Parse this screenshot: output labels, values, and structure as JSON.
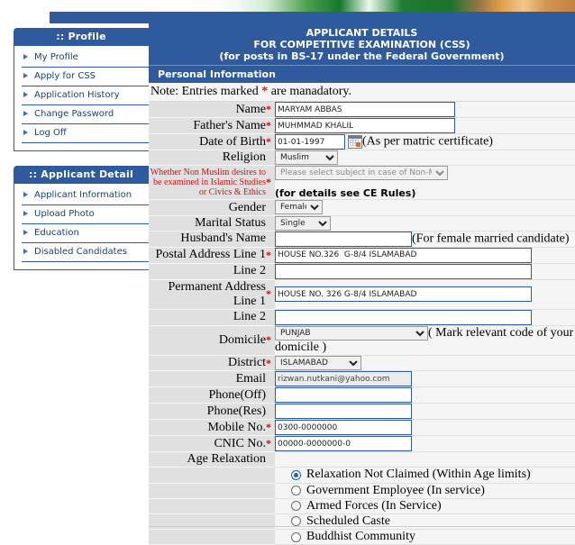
{
  "banner": {
    "alt": "flag-banner-strip"
  },
  "sidebar": {
    "panels": [
      {
        "title": ":: Profile",
        "items": [
          {
            "label": "My Profile"
          },
          {
            "label": "Apply for CSS"
          },
          {
            "label": "Application History"
          },
          {
            "label": "Change Password"
          },
          {
            "label": "Log Off"
          }
        ]
      },
      {
        "title": ":: Applicant Detail",
        "items": [
          {
            "label": "Applicant Information"
          },
          {
            "label": "Upload Photo"
          },
          {
            "label": "Education"
          },
          {
            "label": "Disabled Candidates"
          }
        ]
      }
    ]
  },
  "header": {
    "line1": "APPLICANT DETAILS",
    "line2": "FOR COMPETITIVE EXAMINATION (CSS)",
    "line3": "(for posts in BS-17 under the Federal Government)",
    "section": "Personal Information",
    "note_prefix": "Note: Entries marked ",
    "note_star": "*",
    "note_suffix": " are manadatory."
  },
  "form": {
    "name": {
      "label": "Name",
      "required": "*",
      "value": "MARYAM ABBAS"
    },
    "father_name": {
      "label": "Father's Name",
      "required": "*",
      "value": "MUHMMAD KHALIL"
    },
    "dob": {
      "label": "Date of Birth",
      "required": "*",
      "value": "01-01-1997",
      "hint": "(As per matric certificate)"
    },
    "religion": {
      "label": "Religion",
      "value": "Muslim"
    },
    "non_muslim": {
      "label": "Whether Non Muslim desires to be examined in Islamic Studies or Civics & Ethics",
      "required": "*",
      "value": "Please select subject in case of Non-Muslims",
      "hint": "(for details see CE Rules)"
    },
    "gender": {
      "label": "Gender",
      "value": "Female"
    },
    "marital_status": {
      "label": "Marital Status",
      "value": "Single"
    },
    "husband_name": {
      "label": "Husband's Name",
      "value": "",
      "hint": "(For female married candidate)"
    },
    "postal_line1": {
      "label": "Postal Address Line 1",
      "required": "*",
      "value": "HOUSE NO.326  G-8/4 ISLAMABAD"
    },
    "postal_line2": {
      "label": "Line 2",
      "value": ""
    },
    "permanent_line1": {
      "label": "Permanent Address Line 1",
      "required": "*",
      "value": "HOUSE NO. 326 G-8/4 ISLAMABAD"
    },
    "permanent_line2": {
      "label": "Line 2",
      "value": ""
    },
    "domicile": {
      "label": "Domicile",
      "required": "*",
      "value": "PUNJAB",
      "hint": "( Mark relevant code of your domicile )"
    },
    "district": {
      "label": "District",
      "required": "*",
      "value": "ISLAMABAD"
    },
    "email": {
      "label": "Email",
      "value": "rizwan.nutkani@yahoo.com"
    },
    "phone_off": {
      "label": "Phone(Off)",
      "value": ""
    },
    "phone_res": {
      "label": "Phone(Res)",
      "value": ""
    },
    "mobile": {
      "label": "Mobile No.",
      "required": "*",
      "value": "0300-0000000"
    },
    "cnic": {
      "label": "CNIC No.",
      "required": "*",
      "value": "00000-0000000-0"
    },
    "age_relaxation": {
      "label": "Age Relaxation",
      "options": [
        {
          "label": "Relaxation Not Claimed (Within Age limits)",
          "selected": true
        },
        {
          "label": "Government Employee (In service)",
          "selected": false
        },
        {
          "label": "Armed Forces (In Service)",
          "selected": false
        },
        {
          "label": "Scheduled Caste",
          "selected": false
        },
        {
          "label": "Buddhist Community",
          "selected": false
        }
      ]
    }
  },
  "colors": {
    "brand_blue": "#2f5b9e",
    "label_bg": "#e0e0e0",
    "field_bg": "#f5f5f5",
    "required_red": "#d01010",
    "radio_blue": "#1b5fc4"
  }
}
